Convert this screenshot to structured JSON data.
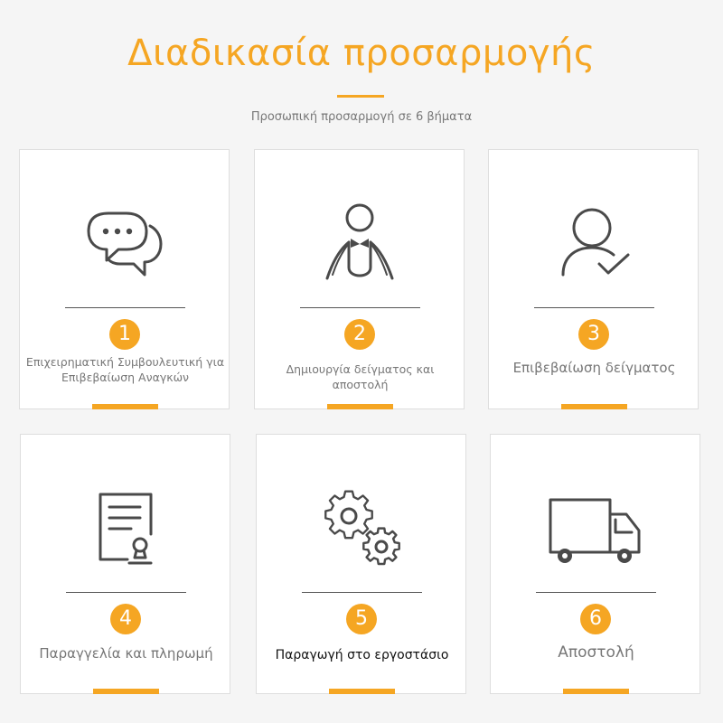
{
  "page": {
    "title": "Διαδικασία προσαρμογής",
    "subtitle": "Προσωπική προσαρμογή σε 6 βήματα",
    "accent_color": "#f5a623"
  },
  "steps": [
    {
      "number": "1",
      "label": "Επιχειρηματική Συμβουλευτική για Επιβεβαίωση Αναγκών",
      "icon": "chat-bubbles-icon"
    },
    {
      "number": "2",
      "label": "Δημιουργία δείγματος και αποστολή",
      "icon": "tailor-mannequin-icon"
    },
    {
      "number": "3",
      "label": "Επιβεβαίωση δείγματος",
      "icon": "user-check-icon"
    },
    {
      "number": "4",
      "label": "Παραγγελία και πληρωμή",
      "icon": "order-document-icon"
    },
    {
      "number": "5",
      "label": "Παραγωγή στο εργοστάσιο",
      "icon": "gears-icon"
    },
    {
      "number": "6",
      "label": "Αποστολή",
      "icon": "delivery-truck-icon"
    }
  ]
}
